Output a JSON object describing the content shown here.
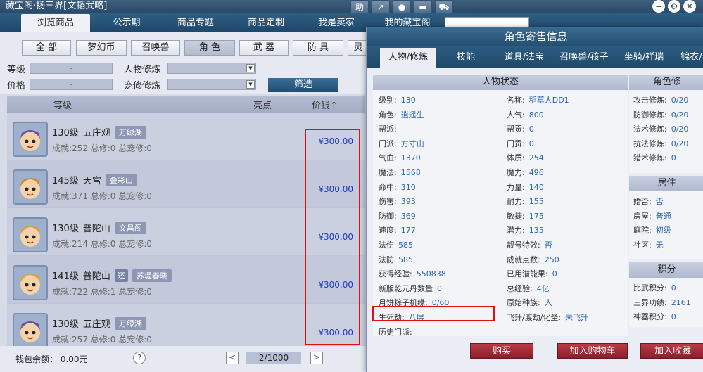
{
  "title": "藏宝阁·扬三界[文韬武略]",
  "toolbar": {
    "help_label": "助",
    "share_icon": "share-icon",
    "stop_icon": "stop-icon",
    "chat_icon": "chat-icon",
    "cart_icon": "cart-icon"
  },
  "nav": {
    "tabs": [
      "浏览商品",
      "公示期",
      "商品专题",
      "商品定制",
      "我是卖家",
      "我的藏宝阁"
    ],
    "active": "浏览商品"
  },
  "categories": [
    "全 部",
    "梦幻币",
    "召唤兽",
    "角 色",
    "武 器",
    "防 具",
    "灵"
  ],
  "filter": {
    "level_label": "等级",
    "level_value": "-",
    "price_label": "价格",
    "price_value": "-",
    "char_cultivation_label": "人物修炼",
    "pet_cultivation_label": "宠修修炼",
    "filter_button": "筛选"
  },
  "list": {
    "headers": {
      "level": "等级",
      "highlight": "亮点",
      "price": "价钱↑"
    },
    "rows": [
      {
        "level": "130级",
        "school": "五庄观",
        "server": "万绿湖",
        "extra": "",
        "stats": "成就:252 总修:0 总宠修:0",
        "price": "¥300.00"
      },
      {
        "level": "145级",
        "school": "天宫",
        "server": "叠彩山",
        "extra": "",
        "stats": "成就:371 总修:0 总宠修:0",
        "price": "¥300.00"
      },
      {
        "level": "130级",
        "school": "普陀山",
        "server": "文昌阁",
        "extra": "",
        "stats": "成就:214 总修:0 总宠修:0",
        "price": "¥300.00"
      },
      {
        "level": "141级",
        "school": "普陀山",
        "server": "苏堤春晓",
        "extra": "还",
        "stats": "成就:722 总修:1 总宠修:0",
        "price": "¥300.00"
      },
      {
        "level": "130级",
        "school": "五庄观",
        "server": "万绿湖",
        "extra": "",
        "stats": "成就:257 总修:0 总宠修:0",
        "price": "¥300.00"
      }
    ]
  },
  "footer": {
    "wallet": "钱包余额： 0.00元",
    "help": "?",
    "page": "2/1000",
    "prev": "<",
    "next": ">"
  },
  "panel": {
    "title": "角色寄售信息",
    "tabs": [
      "人物/修炼",
      "技能",
      "道具/法宝",
      "召唤兽/孩子",
      "坐骑/祥瑞",
      "锦衣/"
    ],
    "status_head": "人物状态",
    "right_head_1": "角色修",
    "right_head_2": "居住",
    "right_head_3": "积分",
    "left_col": [
      {
        "k": "级别:",
        "v": "130"
      },
      {
        "k": "角色:",
        "v": "逍遥生"
      },
      {
        "k": "帮派:",
        "v": ""
      },
      {
        "k": "门派:",
        "v": "方寸山"
      },
      {
        "k": "气血:",
        "v": "1370"
      },
      {
        "k": "魔法:",
        "v": "1568"
      },
      {
        "k": "命中:",
        "v": "310"
      },
      {
        "k": "伤害:",
        "v": "393"
      },
      {
        "k": "防御:",
        "v": "369"
      },
      {
        "k": "速度:",
        "v": "177"
      },
      {
        "k": "法伤",
        "v": "585"
      },
      {
        "k": "法防",
        "v": "585"
      },
      {
        "k": "获得经验:",
        "v": "550838"
      },
      {
        "k": "新版乾元丹数量",
        "v": "0"
      },
      {
        "k": "月饼粽子机缘:",
        "v": "0/60"
      },
      {
        "k": "生死劫:",
        "v": "八层"
      },
      {
        "k": "历史门派:",
        "v": ""
      }
    ],
    "mid_col": [
      {
        "k": "名称:",
        "v": "稻草人DD1"
      },
      {
        "k": "人气:",
        "v": "800"
      },
      {
        "k": "帮贡:",
        "v": "0"
      },
      {
        "k": "门贡:",
        "v": "0"
      },
      {
        "k": "体质:",
        "v": "254"
      },
      {
        "k": "魔力:",
        "v": "496"
      },
      {
        "k": "力量:",
        "v": "140"
      },
      {
        "k": "耐力:",
        "v": "155"
      },
      {
        "k": "敏捷:",
        "v": "175"
      },
      {
        "k": "潜力:",
        "v": "135"
      },
      {
        "k": "靓号特效:",
        "v": "否"
      },
      {
        "k": "成就点数:",
        "v": "250"
      },
      {
        "k": "已用潜能果:",
        "v": "0"
      },
      {
        "k": "总经验:",
        "v": "4亿"
      },
      {
        "k": "原始种族:",
        "v": "人"
      },
      {
        "k": "飞升/渡劫/化圣:",
        "v": "未飞升"
      }
    ],
    "right_col_1": [
      {
        "k": "攻击修炼:",
        "v": "0/20"
      },
      {
        "k": "防御修炼:",
        "v": "0/20"
      },
      {
        "k": "法术修炼:",
        "v": "0/20"
      },
      {
        "k": "抗法修炼:",
        "v": "0/20"
      },
      {
        "k": "猎术修炼:",
        "v": "0"
      }
    ],
    "right_col_2": [
      {
        "k": "婚否:",
        "v": "否"
      },
      {
        "k": "房屋:",
        "v": "普通"
      },
      {
        "k": "庭院:",
        "v": "初级"
      },
      {
        "k": "社区:",
        "v": "无"
      }
    ],
    "right_col_3": [
      {
        "k": "比武积分:",
        "v": "0"
      },
      {
        "k": "三界功绩:",
        "v": "2161"
      },
      {
        "k": "神器积分:",
        "v": "0"
      }
    ],
    "buttons": {
      "buy": "购买",
      "add_cart": "加入购物车",
      "add_fav": "加入收藏"
    }
  },
  "colors": {
    "highlight_box": "#e01010",
    "price": "#1a38c8",
    "header_bg": "#2a4a68"
  }
}
